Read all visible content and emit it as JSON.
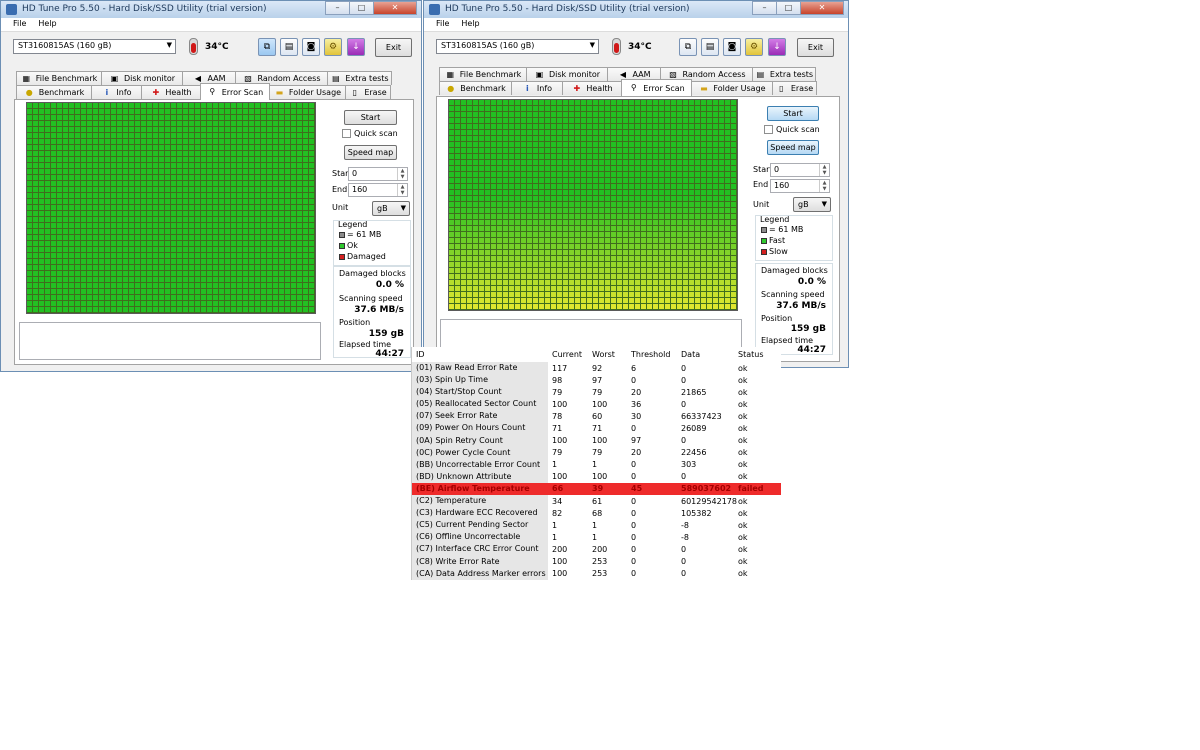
{
  "windows": [
    {
      "title": "HD Tune Pro 5.50 - Hard Disk/SSD Utility (trial version)",
      "menu": [
        "File",
        "Help"
      ],
      "drive": "ST3160815AS (160 gB)",
      "temperature": "34°C",
      "exit_label": "Exit",
      "tabs_top": [
        "File Benchmark",
        "Disk monitor",
        "AAM",
        "Random Access",
        "Extra tests"
      ],
      "tabs_bottom": [
        "Benchmark",
        "Info",
        "Health",
        "Error Scan",
        "Folder Usage",
        "Erase"
      ],
      "active_tab": "Error Scan",
      "start_label": "Start",
      "quick_scan_label": "Quick scan",
      "speed_map_label": "Speed map",
      "start_field_label": "Start",
      "start_value": "0",
      "end_field_label": "End",
      "end_value": "160",
      "unit_label": "Unit",
      "unit_value": "gB",
      "legend_title": "Legend",
      "legend": [
        {
          "label": "= 61 MB",
          "color": "#8c8c8c"
        },
        {
          "label": "Ok",
          "color": "#2ec82e"
        },
        {
          "label": "Damaged",
          "color": "#d42020"
        }
      ],
      "damaged_blocks_label": "Damaged blocks",
      "damaged_blocks_value": "0.0 %",
      "scanning_speed_label": "Scanning speed",
      "scanning_speed_value": "37.6 MB/s",
      "position_label": "Position",
      "position_value": "159 gB",
      "elapsed_label": "Elapsed time",
      "elapsed_value": "44:27"
    },
    {
      "title": "HD Tune Pro 5.50 - Hard Disk/SSD Utility (trial version)",
      "menu": [
        "File",
        "Help"
      ],
      "drive": "ST3160815AS (160 gB)",
      "temperature": "34°C",
      "exit_label": "Exit",
      "tabs_top": [
        "File Benchmark",
        "Disk monitor",
        "AAM",
        "Random Access",
        "Extra tests"
      ],
      "tabs_bottom": [
        "Benchmark",
        "Info",
        "Health",
        "Error Scan",
        "Folder Usage",
        "Erase"
      ],
      "active_tab": "Error Scan",
      "start_label": "Start",
      "quick_scan_label": "Quick scan",
      "speed_map_label": "Speed map",
      "start_field_label": "Start",
      "start_value": "0",
      "end_field_label": "End",
      "end_value": "160",
      "unit_label": "Unit",
      "unit_value": "gB",
      "legend_title": "Legend",
      "legend": [
        {
          "label": "= 61 MB",
          "color": "#8c8c8c"
        },
        {
          "label": "Fast",
          "color": "#2ec82e"
        },
        {
          "label": "Slow",
          "color": "#d42020"
        }
      ],
      "damaged_blocks_label": "Damaged blocks",
      "damaged_blocks_value": "0.0 %",
      "scanning_speed_label": "Scanning speed",
      "scanning_speed_value": "37.6 MB/s",
      "position_label": "Position",
      "position_value": "159 gB",
      "elapsed_label": "Elapsed time",
      "elapsed_value": "44:27"
    }
  ],
  "smart": {
    "headers": [
      "ID",
      "Current",
      "Worst",
      "Threshold",
      "Data",
      "Status"
    ],
    "rows": [
      [
        "(01) Raw Read Error Rate",
        "117",
        "92",
        "6",
        "0",
        "ok"
      ],
      [
        "(03) Spin Up Time",
        "98",
        "97",
        "0",
        "0",
        "ok"
      ],
      [
        "(04) Start/Stop Count",
        "79",
        "79",
        "20",
        "21865",
        "ok"
      ],
      [
        "(05) Reallocated Sector Count",
        "100",
        "100",
        "36",
        "0",
        "ok"
      ],
      [
        "(07) Seek Error Rate",
        "78",
        "60",
        "30",
        "66337423",
        "ok"
      ],
      [
        "(09) Power On Hours Count",
        "71",
        "71",
        "0",
        "26089",
        "ok"
      ],
      [
        "(0A) Spin Retry Count",
        "100",
        "100",
        "97",
        "0",
        "ok"
      ],
      [
        "(0C) Power Cycle Count",
        "79",
        "79",
        "20",
        "22456",
        "ok"
      ],
      [
        "(BB) Uncorrectable Error Count",
        "1",
        "1",
        "0",
        "303",
        "ok"
      ],
      [
        "(BD) Unknown Attribute",
        "100",
        "100",
        "0",
        "0",
        "ok"
      ],
      [
        "(BE) Airflow Temperature",
        "66",
        "39",
        "45",
        "589037602",
        "failed"
      ],
      [
        "(C2) Temperature",
        "34",
        "61",
        "0",
        "60129542178",
        "ok"
      ],
      [
        "(C3) Hardware ECC Recovered",
        "82",
        "68",
        "0",
        "105382",
        "ok"
      ],
      [
        "(C5) Current Pending Sector",
        "1",
        "1",
        "0",
        "-8",
        "ok"
      ],
      [
        "(C6) Offline Uncorrectable",
        "1",
        "1",
        "0",
        "-8",
        "ok"
      ],
      [
        "(C7) Interface CRC Error Count",
        "200",
        "200",
        "0",
        "0",
        "ok"
      ],
      [
        "(C8) Write Error Rate",
        "100",
        "253",
        "0",
        "0",
        "ok"
      ],
      [
        "(CA) Data Address Marker errors",
        "100",
        "253",
        "0",
        "0",
        "ok"
      ]
    ]
  },
  "colors": {
    "block_ok": "#22c022",
    "block_slow": "#e8e830",
    "failed_row": "#ee2b2b"
  }
}
